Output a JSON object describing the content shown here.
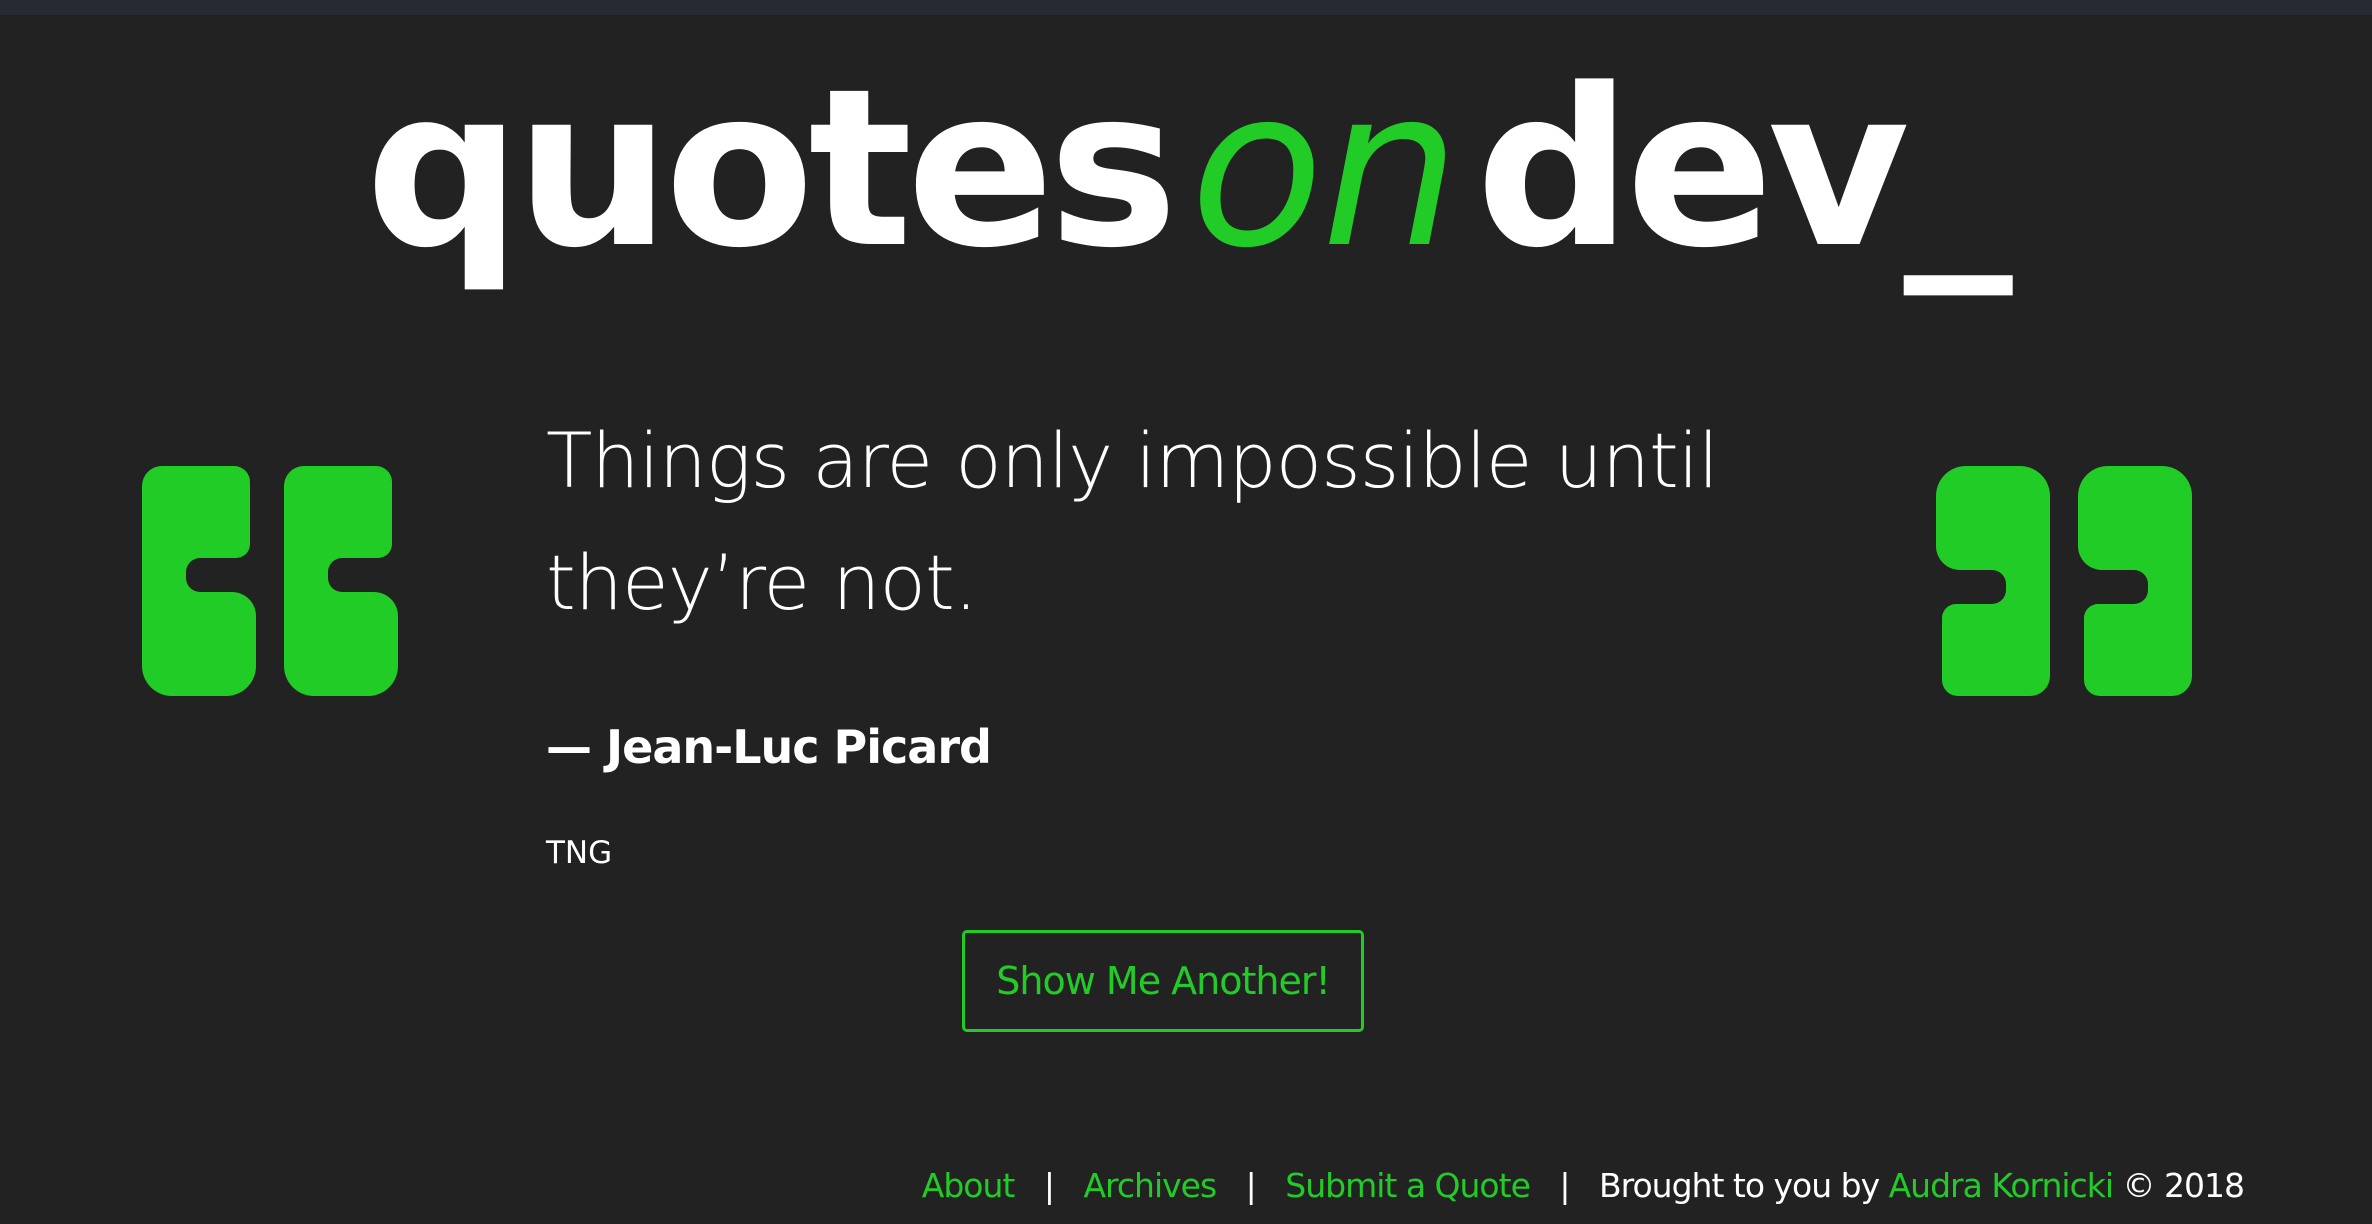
{
  "brand": {
    "word1": "quotes",
    "word2": "on",
    "word3": "dev_"
  },
  "quote": {
    "text": "Things are only impossible until they’re not.",
    "author": "— Jean-Luc Picard",
    "source": "TNG"
  },
  "button": {
    "label": "Show Me Another!"
  },
  "footer": {
    "links": {
      "about": "About",
      "archives": "Archives",
      "submit": "Submit a Quote"
    },
    "separator": "|",
    "brought_by": "Brought to you by",
    "author_link": "Audra Kornicki",
    "copyright": "© 2018"
  },
  "colors": {
    "background": "#222222",
    "accent": "#22cc27",
    "text": "#ffffff"
  },
  "icons": {
    "open_quote": "quote-open-icon",
    "close_quote": "quote-close-icon"
  }
}
